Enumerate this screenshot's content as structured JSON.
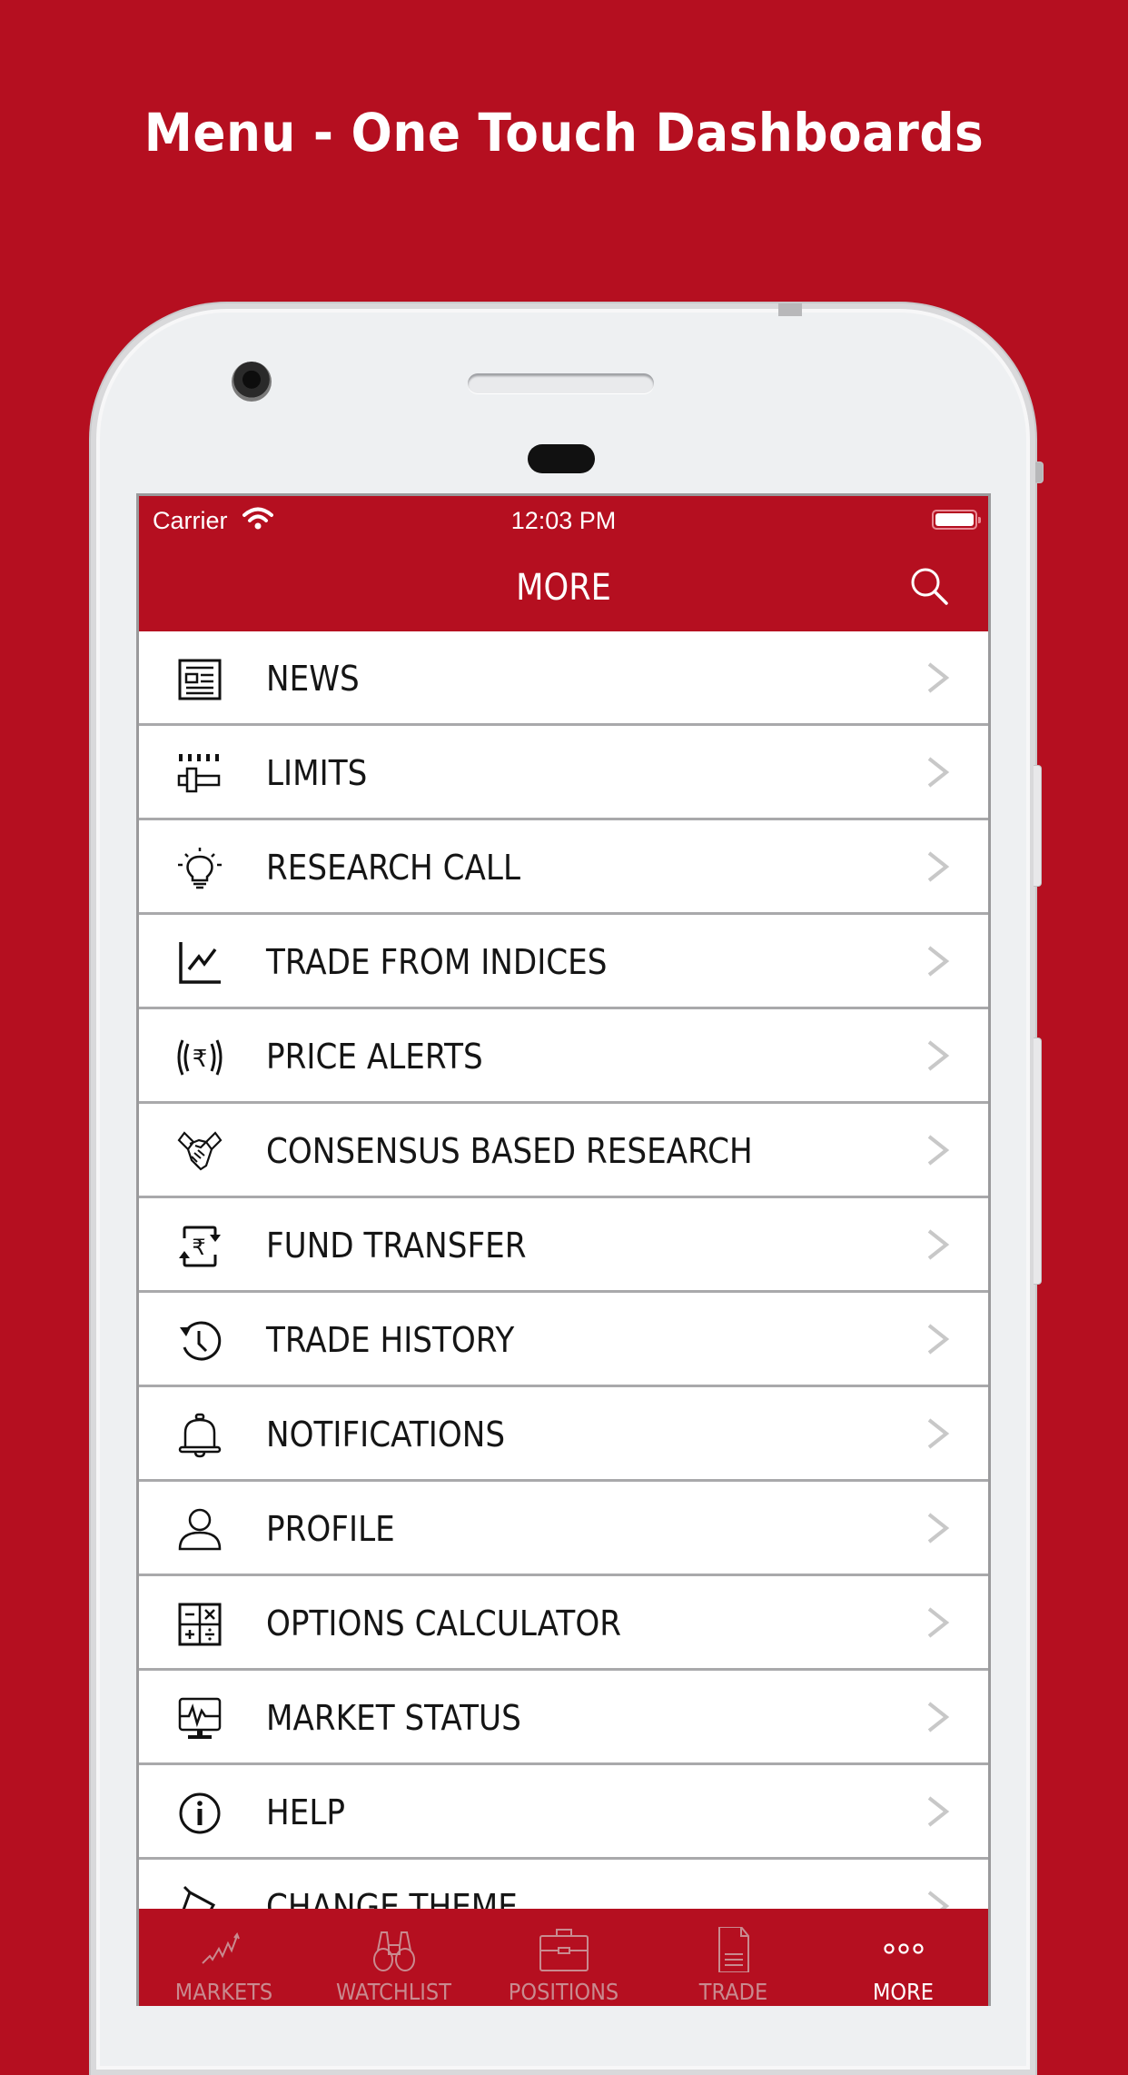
{
  "headline": "Menu - One Touch Dashboards",
  "colors": {
    "brand": "#b50f20",
    "row_divider": "#a9a9ab",
    "chevron": "#c8c8c8",
    "tab_inactive": "#c98a8f",
    "tab_active": "#ffffff"
  },
  "status_bar": {
    "carrier": "Carrier",
    "time": "12:03 PM",
    "wifi_icon": "wifi-icon",
    "battery_icon": "battery-icon"
  },
  "navbar": {
    "title": "MORE",
    "search_icon": "search-icon"
  },
  "menu": {
    "items": [
      {
        "label": "NEWS",
        "icon": "newspaper-icon"
      },
      {
        "label": "LIMITS",
        "icon": "limits-slider-icon"
      },
      {
        "label": "RESEARCH CALL",
        "icon": "lightbulb-icon"
      },
      {
        "label": "TRADE FROM INDICES",
        "icon": "line-chart-icon"
      },
      {
        "label": "PRICE ALERTS",
        "icon": "rupee-alert-icon"
      },
      {
        "label": "CONSENSUS BASED RESEARCH",
        "icon": "handshake-icon"
      },
      {
        "label": "FUND TRANSFER",
        "icon": "rupee-transfer-icon"
      },
      {
        "label": "TRADE HISTORY",
        "icon": "history-icon"
      },
      {
        "label": "NOTIFICATIONS",
        "icon": "bell-icon"
      },
      {
        "label": "PROFILE",
        "icon": "user-icon"
      },
      {
        "label": "OPTIONS CALCULATOR",
        "icon": "calculator-icon"
      },
      {
        "label": "MARKET STATUS",
        "icon": "monitor-pulse-icon"
      },
      {
        "label": "HELP",
        "icon": "info-icon"
      },
      {
        "label": "CHANGE THEME",
        "icon": "paint-bucket-icon"
      }
    ]
  },
  "tabbar": {
    "tabs": [
      {
        "label": "MARKETS",
        "icon": "markets-chart-icon",
        "active": false
      },
      {
        "label": "WATCHLIST",
        "icon": "binoculars-icon",
        "active": false
      },
      {
        "label": "POSITIONS",
        "icon": "briefcase-icon",
        "active": false
      },
      {
        "label": "TRADE",
        "icon": "document-icon",
        "active": false
      },
      {
        "label": "MORE",
        "icon": "more-dots-icon",
        "active": true
      }
    ]
  }
}
